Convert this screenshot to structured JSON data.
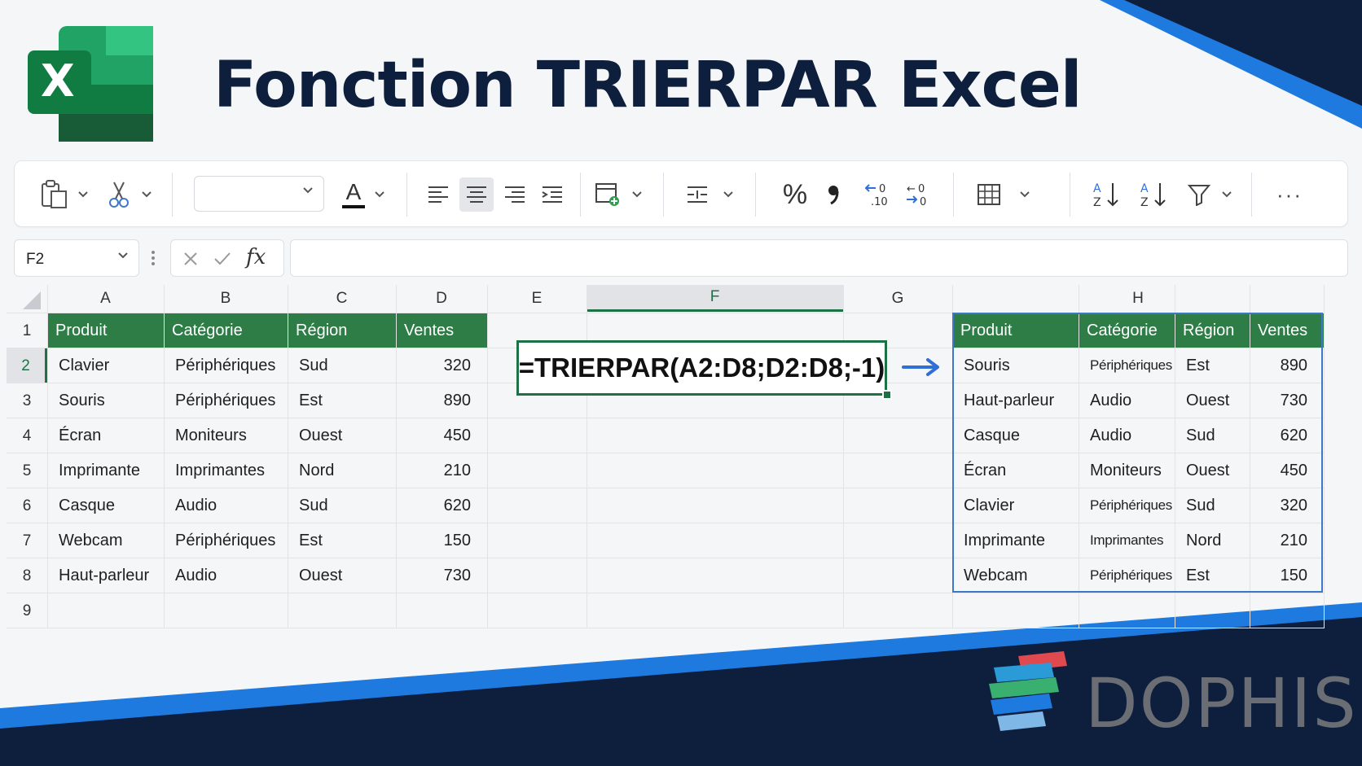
{
  "header": {
    "title": "Fonction TRIERPAR Excel",
    "logo_letter": "X"
  },
  "formula_bar": {
    "name_box": "F2",
    "fx_label": "fx",
    "content": ""
  },
  "ribbon": {
    "icons": [
      "paste-icon",
      "cut-icon",
      "font-color-icon",
      "align-left-icon",
      "align-center-icon",
      "align-right-icon",
      "indent-icon",
      "insert-cells-icon",
      "spacing-icon",
      "percent-icon",
      "comma-icon",
      "increase-decimal-icon",
      "decrease-decimal-icon",
      "borders-icon",
      "sort-ascending-icon",
      "sort-descending-icon",
      "filter-icon",
      "more-icon"
    ],
    "font_color_letter": "A",
    "more_label": "···"
  },
  "grid": {
    "columns": [
      "A",
      "B",
      "C",
      "D",
      "E",
      "F",
      "G",
      "H"
    ],
    "rows": [
      "1",
      "2",
      "3",
      "4",
      "5",
      "6",
      "7",
      "8",
      "9"
    ],
    "selected_column": "F",
    "selected_row": "2"
  },
  "source_table": {
    "headers": [
      "Produit",
      "Catégorie",
      "Région",
      "Ventes"
    ],
    "rows": [
      [
        "Clavier",
        "Périphériques",
        "Sud",
        "320"
      ],
      [
        "Souris",
        "Périphériques",
        "Est",
        "890"
      ],
      [
        "Écran",
        "Moniteurs",
        "Ouest",
        "450"
      ],
      [
        "Imprimante",
        "Imprimantes",
        "Nord",
        "210"
      ],
      [
        "Casque",
        "Audio",
        "Sud",
        "620"
      ],
      [
        "Webcam",
        "Périphériques",
        "Est",
        "150"
      ],
      [
        "Haut-parleur",
        "Audio",
        "Ouest",
        "730"
      ]
    ]
  },
  "formula": "=TRIERPAR(A2:D8;D2:D8;-1)",
  "result_table": {
    "headers": [
      "Produit",
      "Catégorie",
      "Région",
      "Ventes"
    ],
    "rows": [
      [
        "Souris",
        "Périphériques",
        "Est",
        "890"
      ],
      [
        "Haut-parleur",
        "Audio",
        "Ouest",
        "730"
      ],
      [
        "Casque",
        "Audio",
        "Sud",
        "620"
      ],
      [
        "Écran",
        "Moniteurs",
        "Ouest",
        "450"
      ],
      [
        "Clavier",
        "Périphériques",
        "Sud",
        "320"
      ],
      [
        "Imprimante",
        "Imprimantes",
        "Nord",
        "210"
      ],
      [
        "Webcam",
        "Périphériques",
        "Est",
        "150"
      ]
    ]
  },
  "brand": {
    "name": "DOPHIS"
  },
  "colors": {
    "excel_green": "#1e7145",
    "header_green": "#2e7d47",
    "navy": "#0d1f3c",
    "accent_blue": "#1f7ae0",
    "spill_border": "#3f78c9"
  }
}
